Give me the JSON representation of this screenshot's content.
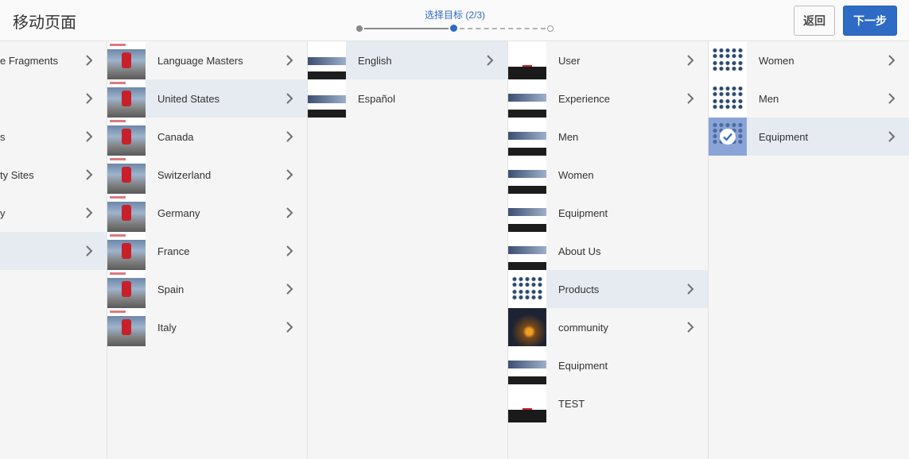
{
  "header": {
    "title": "移动页面",
    "wizard_label": "选择目标 (2/3)",
    "back_label": "返回",
    "next_label": "下一步"
  },
  "columns": [
    {
      "items": [
        "e Fragments",
        "",
        "s",
        "ty Sites",
        "y",
        ""
      ]
    },
    {
      "items": [
        "Language Masters",
        "United States",
        "Canada",
        "Switzerland",
        "Germany",
        "France",
        "Spain",
        "Italy"
      ]
    },
    {
      "items": [
        "English",
        "Español"
      ]
    },
    {
      "items": [
        "User",
        "Experience",
        "Men",
        "Women",
        "Equipment",
        "About Us",
        "Products",
        "community",
        "Equipment",
        "TEST"
      ]
    },
    {
      "items": [
        "Women",
        "Men",
        "Equipment"
      ]
    }
  ],
  "colors": {
    "accent": "#2d6bc4",
    "selected_row": "#e6ebf2"
  }
}
